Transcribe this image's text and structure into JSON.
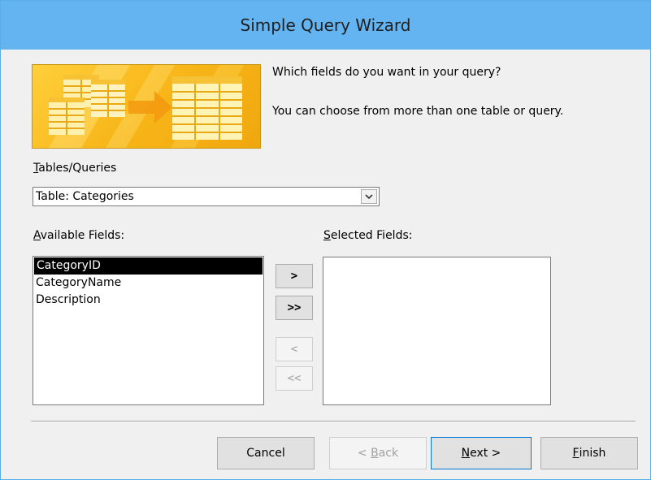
{
  "window": {
    "title": "Simple Query Wizard"
  },
  "prompt": {
    "question": "Which fields do you want in your query?",
    "hint": "You can choose from more than one table or query."
  },
  "tables_queries": {
    "label_accel": "T",
    "label_rest": "ables/Queries",
    "selected_value": "Table: Categories"
  },
  "available_fields": {
    "label_accel": "A",
    "label_rest": "vailable Fields:",
    "items": [
      "CategoryID",
      "CategoryName",
      "Description"
    ],
    "selected_index": 0
  },
  "selected_fields": {
    "label_accel": "S",
    "label_rest": "elected Fields:",
    "items": []
  },
  "move_buttons": {
    "add_one": ">",
    "add_all": ">>",
    "remove_one": "<",
    "remove_all": "<<"
  },
  "footer": {
    "cancel": "Cancel",
    "back_prefix": "< ",
    "back_accel": "B",
    "back_rest": "ack",
    "next_accel": "N",
    "next_rest": "ext >",
    "finish_accel": "F",
    "finish_rest": "inish"
  },
  "colors": {
    "titlebar": "#63b4f1",
    "banner": "#f7b417",
    "selection": "#000000",
    "default_button_border": "#0078d7"
  },
  "icons": {
    "banner": "table-to-table-wizard-illustration",
    "combo_arrow": "chevron-down-icon"
  }
}
